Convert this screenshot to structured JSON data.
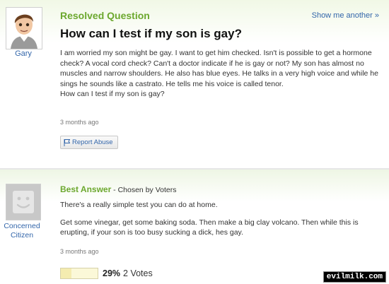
{
  "question": {
    "status": "Resolved Question",
    "show_another": "Show me another »",
    "asker_name": "Gary",
    "title": "How can I test if my son is gay?",
    "body": "I am worried my son might be gay. I want to get him checked. Isn't is possible to get a hormone check? A vocal cord check? Can't a doctor indicate if he is gay or not? My son has almost no muscles and narrow shoulders. He also has blue eyes. He talks in a very high voice and while he sings he sounds like a castrato. He tells me his voice is called tenor.\nHow can I test if my son is gay?",
    "time": "3 months ago",
    "report_label": "Report Abuse"
  },
  "answer": {
    "label": "Best Answer",
    "chosen_by": " - Chosen by Voters",
    "answerer_name": "Concerned Citizen",
    "paragraph_1": "There's a really simple test you can do at home.",
    "paragraph_2": "Get some vinegar, get some baking soda. Then make a big clay volcano. Then while this is erupting, if your son is too busy sucking a dick, hes gay.",
    "time": "3 months ago",
    "vote_percent_text": "29%",
    "vote_percent": 0.29,
    "vote_count_text": "2 Votes"
  },
  "watermark": "evilmilk.com",
  "colors": {
    "accent_green": "#6ca82e",
    "link_blue": "#3366aa"
  },
  "icons": {
    "asker_avatar": "cartoon-boy-avatar-icon",
    "answerer_avatar": "default-smiley-avatar-icon",
    "report": "flag-icon"
  }
}
